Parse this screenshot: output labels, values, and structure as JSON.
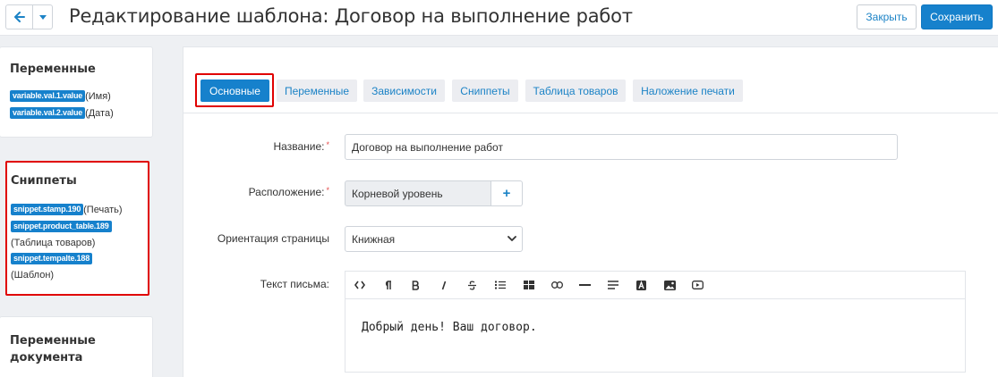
{
  "header": {
    "back_icon": "arrow-left-icon",
    "dropdown_icon": "caret-down-icon",
    "title": "Редактирование шаблона: Договор на выполнение работ",
    "close_label": "Закрыть",
    "save_label": "Сохранить"
  },
  "sidebar": {
    "variables": {
      "title": "Переменные",
      "items": [
        {
          "tag": "variable.val.1.value",
          "desc": "(Имя)"
        },
        {
          "tag": "variable.val.2.value",
          "desc": "(Дата)"
        }
      ]
    },
    "snippets": {
      "title": "Сниппеты",
      "items": [
        {
          "tag": "snippet.stamp.190",
          "desc": "(Печать)"
        },
        {
          "tag": "snippet.product_table.189",
          "desc": "(Таблица товаров)"
        },
        {
          "tag": "snippet.tempalte.188",
          "desc": "(Шаблон)"
        }
      ]
    },
    "doc_variables": {
      "title_line1": "Переменные",
      "title_line2": "документа"
    }
  },
  "tabs": [
    {
      "label": "Основные",
      "active": true
    },
    {
      "label": "Переменные",
      "active": false
    },
    {
      "label": "Зависимости",
      "active": false
    },
    {
      "label": "Сниппеты",
      "active": false
    },
    {
      "label": "Таблица товаров",
      "active": false
    },
    {
      "label": "Наложение печати",
      "active": false
    }
  ],
  "form": {
    "name_label": "Название:",
    "name_value": "Договор на выполнение работ",
    "location_label": "Расположение:",
    "location_value": "Корневой уровень",
    "location_add": "+",
    "orientation_label": "Ориентация страницы",
    "orientation_value": "Книжная",
    "text_label": "Текст письма:",
    "required_mark": "*"
  },
  "editor": {
    "toolbar": [
      "code-icon",
      "paragraph-icon",
      "bold-icon",
      "italic-icon",
      "strikethrough-icon",
      "list-icon",
      "table-icon",
      "link-icon",
      "horizontal-rule-icon",
      "align-icon",
      "font-color-icon",
      "image-icon",
      "video-icon"
    ],
    "body": "Добрый день! Ваш договор."
  },
  "colors": {
    "accent": "#1681cc",
    "highlight": "#e00000",
    "background": "#eef0f3"
  }
}
